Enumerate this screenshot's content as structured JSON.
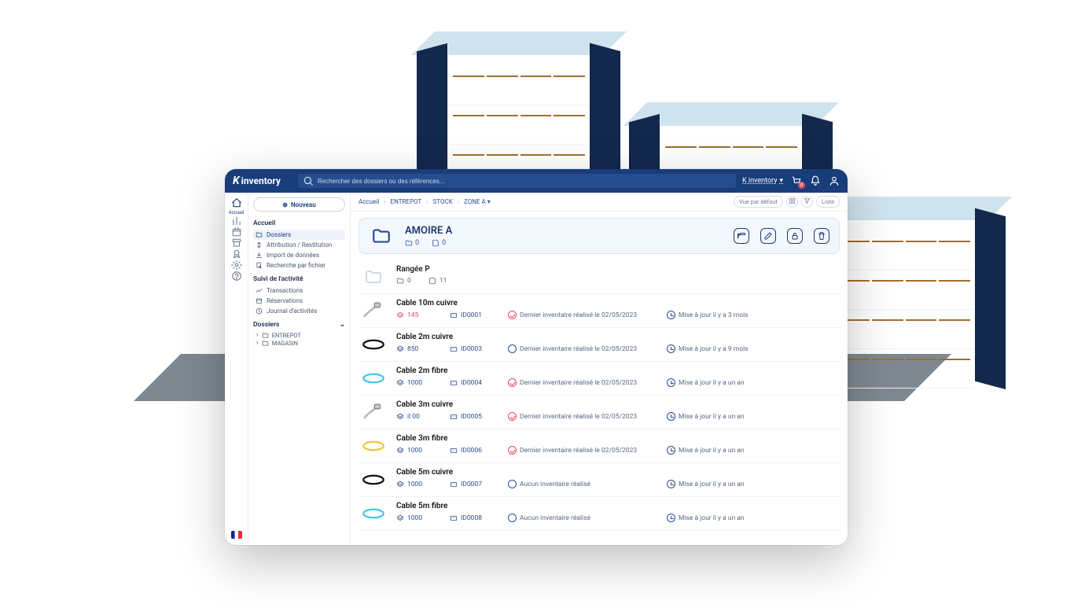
{
  "app": {
    "name": "inventory",
    "logo_mark": "K"
  },
  "topbar": {
    "search_placeholder": "Rechercher des dossiers ou des références...",
    "tenant": "K inventory",
    "cart_count": 0
  },
  "rail": {
    "items": [
      {
        "name": "home",
        "label": "Accueil",
        "active": true
      },
      {
        "name": "stats",
        "label": "",
        "active": false
      },
      {
        "name": "calendar",
        "label": "",
        "active": false
      },
      {
        "name": "archive",
        "label": "",
        "active": false
      },
      {
        "name": "badge",
        "label": "",
        "active": false
      },
      {
        "name": "settings",
        "label": "",
        "active": false
      },
      {
        "name": "support",
        "label": "",
        "active": false
      }
    ]
  },
  "side": {
    "new_button": "Nouveau",
    "sections": {
      "accueil_head": "Accueil",
      "accueil_items": [
        {
          "name": "dossiers",
          "label": "Dossiers",
          "active": true
        },
        {
          "name": "attribution",
          "label": "Attribution / Restitution"
        },
        {
          "name": "import",
          "label": "Import de données"
        },
        {
          "name": "recherche",
          "label": "Recherche par fichier"
        }
      ],
      "suivi_head": "Suivi de l'activité",
      "suivi_items": [
        {
          "name": "transactions",
          "label": "Transactions"
        },
        {
          "name": "reservations",
          "label": "Réservations"
        },
        {
          "name": "journal",
          "label": "Journal d'activités"
        }
      ],
      "dossiers_head": "Dossiers",
      "tree": [
        {
          "name": "entrepot",
          "label": "ENTREPOT"
        },
        {
          "name": "magasin",
          "label": "MAGASIN"
        }
      ]
    }
  },
  "breadcrumbs": [
    {
      "label": "Accueil"
    },
    {
      "label": "ENTREPOT"
    },
    {
      "label": "STOCK"
    },
    {
      "label": "ZONE A",
      "dropdown": true
    }
  ],
  "view_controls": {
    "default_view": "Vue par défaut",
    "view_mode": "Liste"
  },
  "hero": {
    "title": "AMOIRE A",
    "folders": 0,
    "items": 0
  },
  "rows": [
    {
      "type": "folder",
      "name": "Rangée P",
      "folders": 0,
      "items": 11
    },
    {
      "type": "item",
      "thumb": "copper-cable",
      "name": "Cable 10m cuivre",
      "qty": 145,
      "qty_alert": true,
      "ref": "ID0001",
      "inv": "Dernier inventaire réalisé le 02/05/2023",
      "inv_alert": true,
      "updated": "Mise à jour il y a 3 mois"
    },
    {
      "type": "item",
      "thumb": "oval-black",
      "name": "Cable 2m cuivre",
      "qty": 850,
      "ref": "ID0003",
      "inv": "Dernier inventaire réalisé le 02/05/2023",
      "updated": "Mise à jour il y a 9 mois"
    },
    {
      "type": "item",
      "thumb": "oval-cyan",
      "name": "Cable 2m fibre",
      "qty": 1000,
      "ref": "ID0004",
      "inv": "Dernier inventaire réalisé le 02/05/2023",
      "inv_alert": true,
      "updated": "Mise à jour il y a un an"
    },
    {
      "type": "item",
      "thumb": "copper-cable",
      "name": "Cable 3m cuivre",
      "qty": "il 00",
      "ref": "ID0005",
      "inv": "Dernier inventaire réalisé le 02/05/2023",
      "inv_alert": true,
      "updated": "Mise à jour il y a un an"
    },
    {
      "type": "item",
      "thumb": "oval-yellow",
      "name": "Cable 3m fibre",
      "qty": 1000,
      "ref": "ID0006",
      "inv": "Dernier inventaire réalisé le 02/05/2023",
      "inv_alert": true,
      "updated": "Mise à jour il y a un an"
    },
    {
      "type": "item",
      "thumb": "oval-black",
      "name": "Cable 5m cuivre",
      "qty": 1000,
      "ref": "ID0007",
      "inv": "Aucun inventaire réalisé",
      "updated": "Mise à jour il y a un an"
    },
    {
      "type": "item",
      "thumb": "oval-cyan",
      "name": "Cable 5m fibre",
      "qty": 1000,
      "ref": "ID0008",
      "inv": "Aucun inventaire réalisé",
      "updated": "Mise à jour il y a un an"
    }
  ]
}
